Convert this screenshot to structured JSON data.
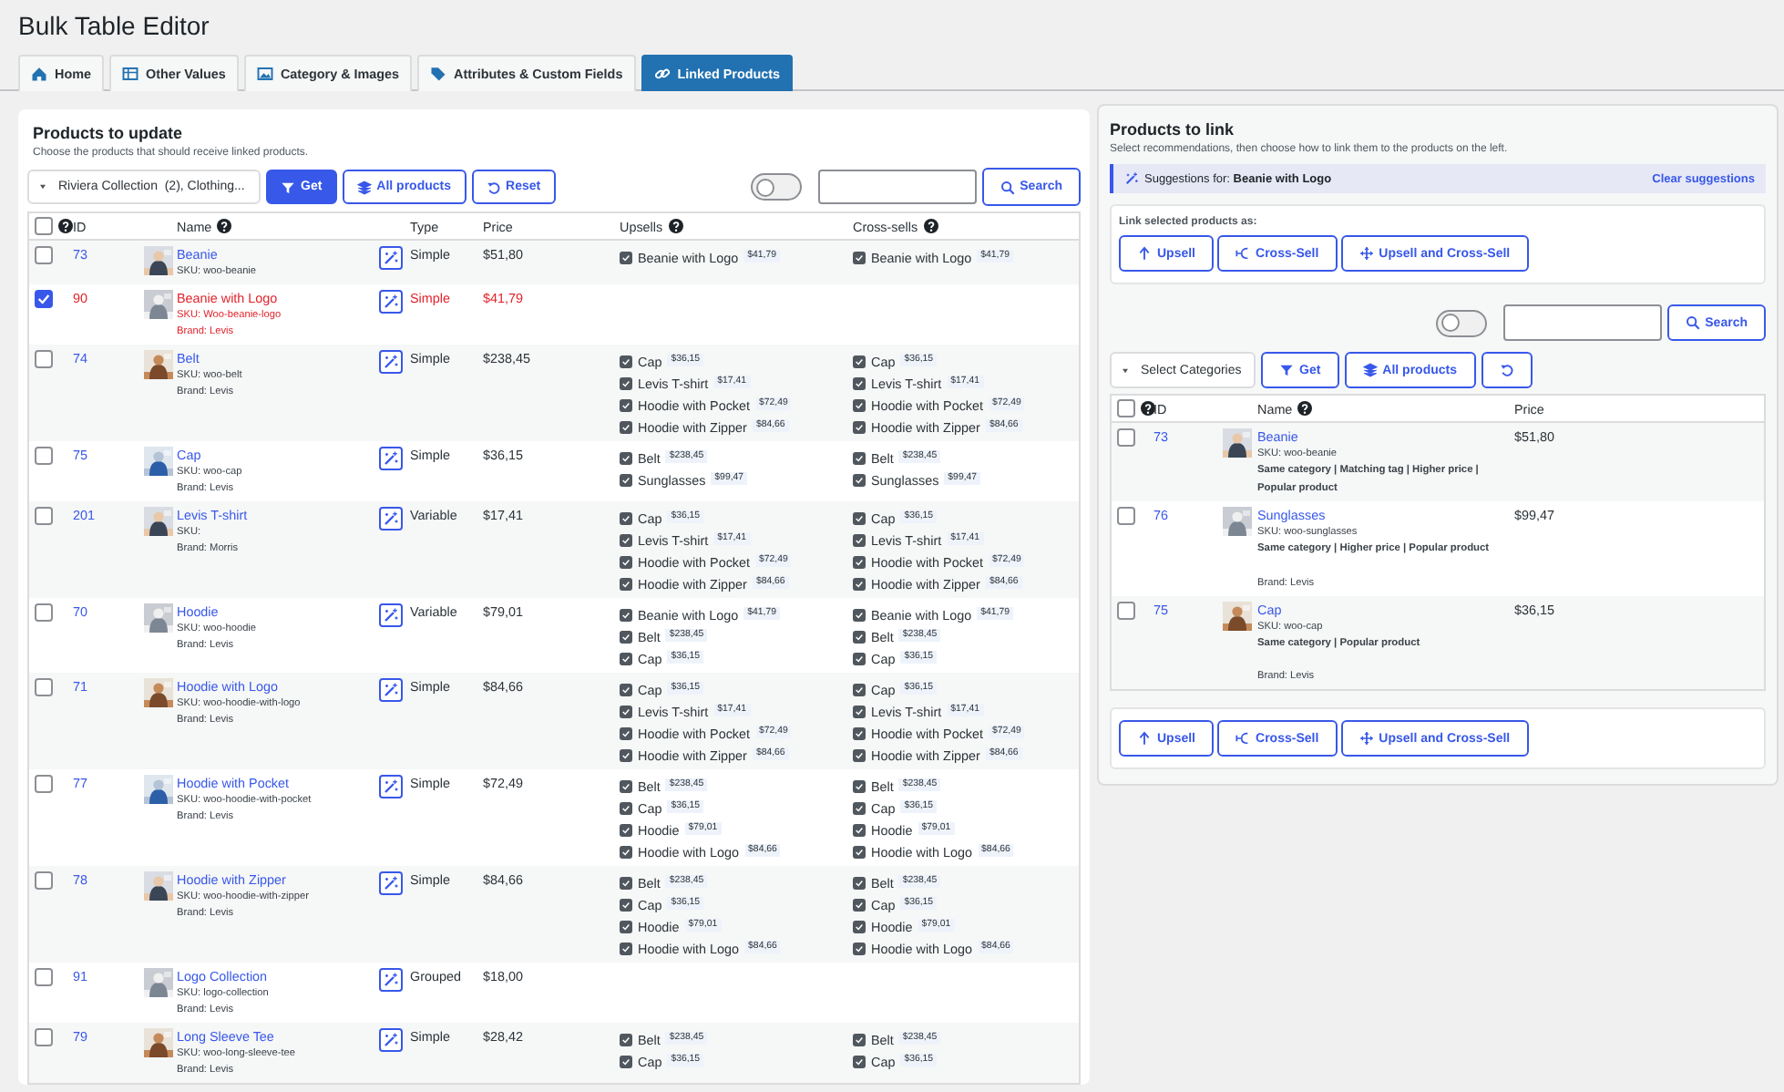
{
  "title": "Bulk Table Editor",
  "tabs": [
    {
      "label": "Home",
      "selected": false
    },
    {
      "label": "Other Values",
      "selected": false
    },
    {
      "label": "Category & Images",
      "selected": false
    },
    {
      "label": "Attributes & Custom Fields",
      "selected": false
    },
    {
      "label": "Linked Products",
      "selected": true
    }
  ],
  "left": {
    "heading": "Products to update",
    "description": "Choose the products that should receive linked products.",
    "category_filter": "Riviera Collection  (2), Clothing...",
    "buttons": [
      {
        "label": "Get",
        "primary": true
      },
      {
        "label": "All products",
        "primary": false
      },
      {
        "label": "Reset",
        "primary": false
      }
    ],
    "toggle": {
      "on": false
    },
    "search_button": "Search",
    "select_all": false,
    "columns": [
      {
        "label": "ID",
        "help": false
      },
      {
        "label": "Name",
        "help": true
      },
      {
        "label": "Type",
        "help": false
      },
      {
        "label": "Price",
        "help": false
      },
      {
        "label": "Upsells",
        "help": true
      },
      {
        "label": "Cross-sells",
        "help": true
      }
    ],
    "rows": [
      {
        "id": "73",
        "name": "Beanie",
        "sku": "SKU: woo-beanie",
        "type": "Simple",
        "price": "$51,80",
        "selected": false,
        "upsells": [
          {
            "name": "Beanie with Logo",
            "price": "$41,79",
            "checked": true
          }
        ],
        "cross_sells": [
          {
            "name": "Beanie with Logo",
            "price": "$41,79",
            "checked": true
          }
        ]
      },
      {
        "id": "90",
        "name": "Beanie with Logo",
        "sku": "SKU: Woo-beanie-logo",
        "brand": "Brand: Levis",
        "type": "Simple",
        "price": "$41,79",
        "selected": true
      },
      {
        "id": "74",
        "name": "Belt",
        "sku": "SKU: woo-belt",
        "brand": "Brand: Levis",
        "type": "Simple",
        "price": "$238,45",
        "selected": false,
        "upsells": [
          {
            "name": "Cap",
            "price": "$36,15",
            "checked": true
          },
          {
            "name": "Levis T-shirt",
            "price": "$17,41",
            "checked": true
          },
          {
            "name": "Hoodie with Pocket",
            "price": "$72,49",
            "checked": true
          },
          {
            "name": "Hoodie with Zipper",
            "price": "$84,66",
            "checked": true
          }
        ],
        "cross_sells": [
          {
            "name": "Cap",
            "price": "$36,15",
            "checked": true
          },
          {
            "name": "Levis T-shirt",
            "price": "$17,41",
            "checked": true
          },
          {
            "name": "Hoodie with Pocket",
            "price": "$72,49",
            "checked": true
          },
          {
            "name": "Hoodie with Zipper",
            "price": "$84,66",
            "checked": true
          }
        ]
      },
      {
        "id": "75",
        "name": "Cap",
        "sku": "SKU: woo-cap",
        "brand": "Brand: Levis",
        "type": "Simple",
        "price": "$36,15",
        "selected": false,
        "upsells": [
          {
            "name": "Belt",
            "price": "$238,45",
            "checked": true
          },
          {
            "name": "Sunglasses",
            "price": "$99,47",
            "checked": true
          }
        ],
        "cross_sells": [
          {
            "name": "Belt",
            "price": "$238,45",
            "checked": true
          },
          {
            "name": "Sunglasses",
            "price": "$99,47",
            "checked": true
          }
        ]
      },
      {
        "id": "201",
        "name": "Levis T-shirt",
        "sku": "SKU:",
        "brand": "Brand: Morris",
        "type": "Variable",
        "price": "$17,41",
        "selected": false,
        "upsells": [
          {
            "name": "Cap",
            "price": "$36,15",
            "checked": true
          },
          {
            "name": "Levis T-shirt",
            "price": "$17,41",
            "checked": true
          },
          {
            "name": "Hoodie with Pocket",
            "price": "$72,49",
            "checked": true
          },
          {
            "name": "Hoodie with Zipper",
            "price": "$84,66",
            "checked": true
          }
        ],
        "cross_sells": [
          {
            "name": "Cap",
            "price": "$36,15",
            "checked": true
          },
          {
            "name": "Levis T-shirt",
            "price": "$17,41",
            "checked": true
          },
          {
            "name": "Hoodie with Pocket",
            "price": "$72,49",
            "checked": true
          },
          {
            "name": "Hoodie with Zipper",
            "price": "$84,66",
            "checked": true
          }
        ]
      },
      {
        "id": "70",
        "name": "Hoodie",
        "sku": "SKU: woo-hoodie",
        "brand": "Brand: Levis",
        "type": "Variable",
        "price": "$79,01",
        "selected": false,
        "upsells": [
          {
            "name": "Beanie with Logo",
            "price": "$41,79",
            "checked": true
          },
          {
            "name": "Belt",
            "price": "$238,45",
            "checked": true
          },
          {
            "name": "Cap",
            "price": "$36,15",
            "checked": true
          }
        ],
        "cross_sells": [
          {
            "name": "Beanie with Logo",
            "price": "$41,79",
            "checked": true
          },
          {
            "name": "Belt",
            "price": "$238,45",
            "checked": true
          },
          {
            "name": "Cap",
            "price": "$36,15",
            "checked": true
          }
        ]
      },
      {
        "id": "71",
        "name": "Hoodie with Logo",
        "sku": "SKU: woo-hoodie-with-logo",
        "brand": "Brand: Levis",
        "type": "Simple",
        "price": "$84,66",
        "selected": false,
        "upsells": [
          {
            "name": "Cap",
            "price": "$36,15",
            "checked": true
          },
          {
            "name": "Levis T-shirt",
            "price": "$17,41",
            "checked": true
          },
          {
            "name": "Hoodie with Pocket",
            "price": "$72,49",
            "checked": true
          },
          {
            "name": "Hoodie with Zipper",
            "price": "$84,66",
            "checked": true
          }
        ],
        "cross_sells": [
          {
            "name": "Cap",
            "price": "$36,15",
            "checked": true
          },
          {
            "name": "Levis T-shirt",
            "price": "$17,41",
            "checked": true
          },
          {
            "name": "Hoodie with Pocket",
            "price": "$72,49",
            "checked": true
          },
          {
            "name": "Hoodie with Zipper",
            "price": "$84,66",
            "checked": true
          }
        ]
      },
      {
        "id": "77",
        "name": "Hoodie with Pocket",
        "sku": "SKU: woo-hoodie-with-pocket",
        "brand": "Brand: Levis",
        "type": "Simple",
        "price": "$72,49",
        "selected": false,
        "upsells": [
          {
            "name": "Belt",
            "price": "$238,45",
            "checked": true
          },
          {
            "name": "Cap",
            "price": "$36,15",
            "checked": true
          },
          {
            "name": "Hoodie",
            "price": "$79,01",
            "checked": true
          },
          {
            "name": "Hoodie with Logo",
            "price": "$84,66",
            "checked": true
          }
        ],
        "cross_sells": [
          {
            "name": "Belt",
            "price": "$238,45",
            "checked": true
          },
          {
            "name": "Cap",
            "price": "$36,15",
            "checked": true
          },
          {
            "name": "Hoodie",
            "price": "$79,01",
            "checked": true
          },
          {
            "name": "Hoodie with Logo",
            "price": "$84,66",
            "checked": true
          }
        ]
      },
      {
        "id": "78",
        "name": "Hoodie with Zipper",
        "sku": "SKU: woo-hoodie-with-zipper",
        "brand": "Brand: Levis",
        "type": "Simple",
        "price": "$84,66",
        "selected": false,
        "upsells": [
          {
            "name": "Belt",
            "price": "$238,45",
            "checked": true
          },
          {
            "name": "Cap",
            "price": "$36,15",
            "checked": true
          },
          {
            "name": "Hoodie",
            "price": "$79,01",
            "checked": true
          },
          {
            "name": "Hoodie with Logo",
            "price": "$84,66",
            "checked": true
          }
        ],
        "cross_sells": [
          {
            "name": "Belt",
            "price": "$238,45",
            "checked": true
          },
          {
            "name": "Cap",
            "price": "$36,15",
            "checked": true
          },
          {
            "name": "Hoodie",
            "price": "$79,01",
            "checked": true
          },
          {
            "name": "Hoodie with Logo",
            "price": "$84,66",
            "checked": true
          }
        ]
      },
      {
        "id": "91",
        "name": "Logo Collection",
        "sku": "SKU: logo-collection",
        "brand": "Brand: Levis",
        "type": "Grouped",
        "price": "$18,00",
        "selected": false
      },
      {
        "id": "79",
        "name": "Long Sleeve Tee",
        "sku": "SKU: woo-long-sleeve-tee",
        "brand": "Brand: Levis",
        "type": "Simple",
        "price": "$28,42",
        "selected": false,
        "upsells": [
          {
            "name": "Belt",
            "price": "$238,45",
            "checked": true
          },
          {
            "name": "Cap",
            "price": "$36,15",
            "checked": true
          }
        ],
        "cross_sells": [
          {
            "name": "Belt",
            "price": "$238,45",
            "checked": true
          },
          {
            "name": "Cap",
            "price": "$36,15",
            "checked": true
          }
        ]
      }
    ]
  },
  "right": {
    "heading": "Products to link",
    "description": "Select recommendations, then choose how to link them to the products on the left.",
    "suggestion": "Suggestions for: **Beanie with Logo**",
    "clear_link": "Clear suggestions",
    "link_label": "Link selected products as:",
    "link_buttons": [
      "Upsell",
      "Cross-Sell",
      "Upsell and Cross-Sell"
    ],
    "toggle": {
      "on": false
    },
    "search_button": "Search",
    "category_filter": "Select Categories",
    "buttons": [
      {
        "label": "Get",
        "primary": false
      },
      {
        "label": "All products",
        "primary": false
      },
      {
        "primary": false
      }
    ],
    "select_all": false,
    "columns": [
      {
        "label": "ID",
        "help": false
      },
      {
        "label": "Name",
        "help": true
      },
      {
        "label": "Price",
        "help": false
      }
    ],
    "rows": [
      {
        "id": "73",
        "name": "Beanie",
        "sku": "SKU: woo-beanie",
        "reasons": "Same category | Matching tag | Higher price | Popular product",
        "price": "$51,80",
        "selected": false
      },
      {
        "id": "76",
        "name": "Sunglasses",
        "sku": "SKU: woo-sunglasses",
        "reasons": "Same category | Higher price | Popular product",
        "brand": "Brand: Levis",
        "price": "$99,47",
        "selected": false
      },
      {
        "id": "75",
        "name": "Cap",
        "sku": "SKU: woo-cap",
        "reasons": "Same category | Popular product",
        "brand": "Brand: Levis",
        "price": "$36,15",
        "selected": false
      }
    ],
    "bottom_link_buttons": [
      "Upsell",
      "Cross-Sell",
      "Upsell and Cross-Sell"
    ]
  }
}
